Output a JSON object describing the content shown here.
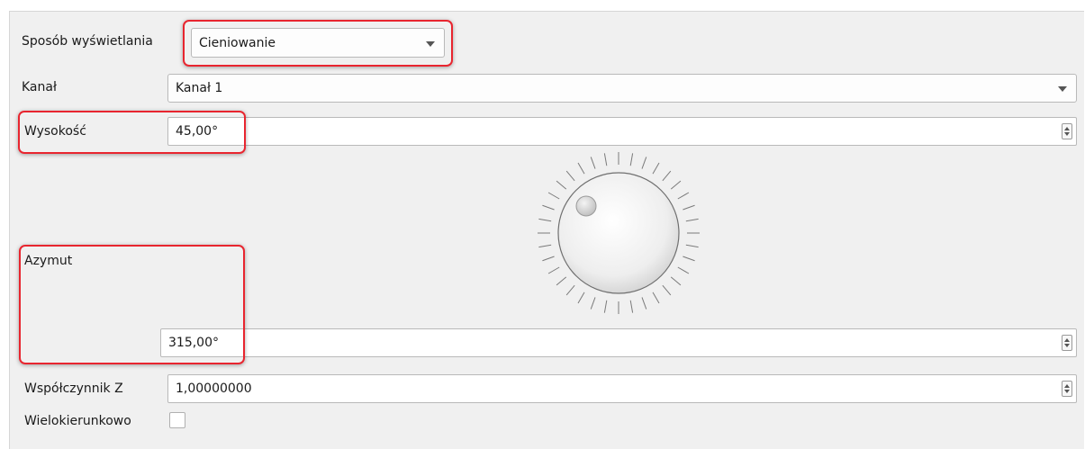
{
  "display_mode": {
    "label": "Sposób wyświetlania",
    "value": "Cieniowanie"
  },
  "channel": {
    "label": "Kanał",
    "value": "Kanał 1"
  },
  "altitude": {
    "label": "Wysokość",
    "value": "45,00°"
  },
  "azimuth": {
    "label": "Azymut",
    "value": "315,00°"
  },
  "z_factor": {
    "label": "Współczynnik Z",
    "value": "1,00000000"
  },
  "multidirectional": {
    "label": "Wielokierunkowo",
    "checked": false
  },
  "colors": {
    "highlight": "#e8252f",
    "panel_bg": "#f0f0f0"
  },
  "icons": {
    "dropdown": "chevron-down-icon",
    "spinner": "spin-arrows-icon",
    "dial": "azimuth-dial"
  }
}
